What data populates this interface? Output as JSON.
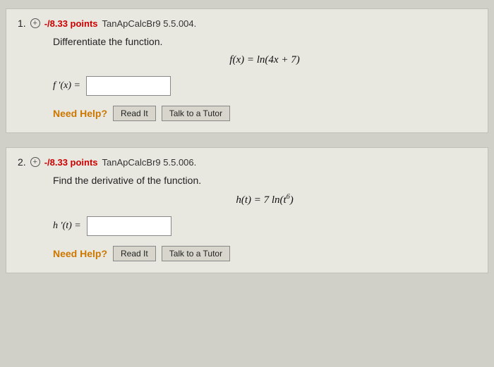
{
  "questions": [
    {
      "number": "1.",
      "points": "-/8.33 points",
      "reference": "TanApCalcBr9 5.5.004.",
      "instruction": "Differentiate the function.",
      "function_display": "f(x) = ln(4x + 7)",
      "answer_label": "f ′(x) =",
      "help_label": "Need Help?",
      "button1": "Read It",
      "button2": "Talk to a Tutor"
    },
    {
      "number": "2.",
      "points": "-/8.33 points",
      "reference": "TanApCalcBr9 5.5.006.",
      "instruction": "Find the derivative of the function.",
      "function_display": "h(t) = 7 ln(t⁶)",
      "answer_label": "h ′(t) =",
      "help_label": "Need Help?",
      "button1": "Read It",
      "button2": "Talk to a Tutor"
    }
  ]
}
